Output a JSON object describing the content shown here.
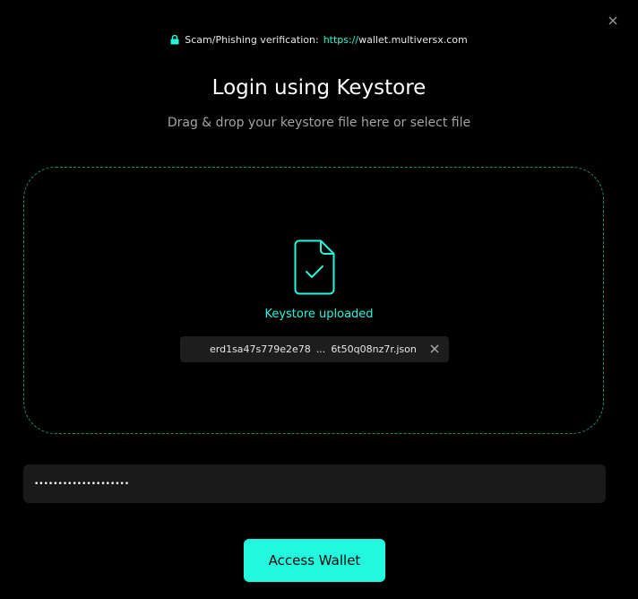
{
  "dialog": {
    "close_label": "×"
  },
  "verification": {
    "label": "Scam/Phishing verification:",
    "url_scheme": "https://",
    "url_domain": "wallet.multiversx.com"
  },
  "header": {
    "title": "Login using Keystore",
    "subtitle": "Drag & drop your keystore file here or select file"
  },
  "dropzone": {
    "status": "Keystore uploaded",
    "file_name_start": "erd1sa47s779e2e78",
    "file_name_ellipsis": "...",
    "file_name_end": "6t50q08nz7r.json"
  },
  "password": {
    "value": "••••••••••••••••••••"
  },
  "actions": {
    "access_label": "Access Wallet"
  },
  "colors": {
    "accent": "#23f7dd",
    "background": "#000000",
    "dashed_border": "#1f8c7a",
    "input_bg": "#1a1a1a"
  },
  "icons": [
    "close-icon",
    "lock-icon",
    "file-check-icon",
    "remove-file-icon"
  ]
}
